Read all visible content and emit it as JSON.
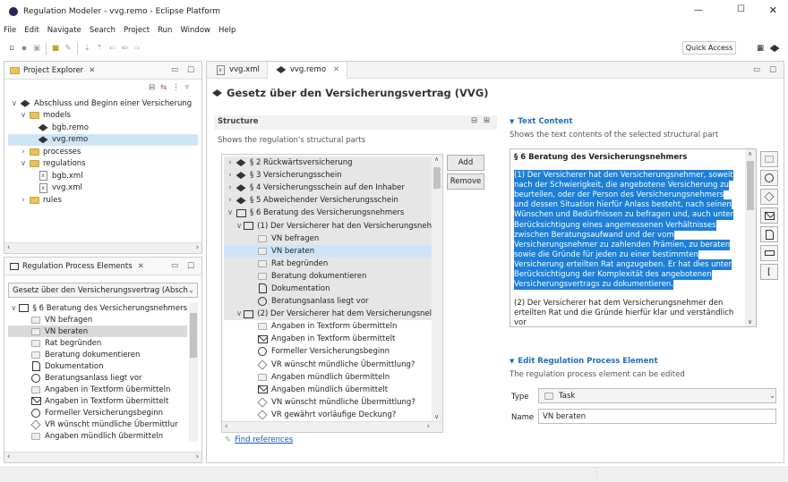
{
  "window": {
    "title": "Regulation Modeler - vvg.remo - Eclipse Platform",
    "min": "—",
    "max": "☐",
    "close": "✕"
  },
  "menu": [
    "File",
    "Edit",
    "Navigate",
    "Search",
    "Project",
    "Run",
    "Window",
    "Help"
  ],
  "toolbar": {
    "quick_access": "Quick Access"
  },
  "project_explorer": {
    "title": "Project Explorer",
    "close": "✕",
    "items": [
      {
        "label": "Abschluss und Beginn einer Versicherung",
        "indent": 0,
        "caret": "∨",
        "icon": "remo"
      },
      {
        "label": "models",
        "indent": 1,
        "caret": "∨",
        "icon": "folder"
      },
      {
        "label": "bgb.remo",
        "indent": 2,
        "caret": "",
        "icon": "remo"
      },
      {
        "label": "vvg.remo",
        "indent": 2,
        "caret": "",
        "icon": "remo",
        "selected": true
      },
      {
        "label": "processes",
        "indent": 1,
        "caret": "›",
        "icon": "folder"
      },
      {
        "label": "regulations",
        "indent": 1,
        "caret": "∨",
        "icon": "folder"
      },
      {
        "label": "bgb.xml",
        "indent": 2,
        "caret": "",
        "icon": "xml"
      },
      {
        "label": "vvg.xml",
        "indent": 2,
        "caret": "",
        "icon": "xml"
      },
      {
        "label": "rules",
        "indent": 1,
        "caret": "›",
        "icon": "folder"
      }
    ]
  },
  "rpe": {
    "title": "Regulation Process Elements",
    "close": "✕",
    "dropdown": "Gesetz über den Versicherungsvertrag (Abschlı",
    "items": [
      {
        "label": "§ 6 Beratung des Versicherungsnehmers",
        "icon": "book",
        "indent": 0,
        "caret": "∨"
      },
      {
        "label": "VN befragen",
        "icon": "task",
        "indent": 1
      },
      {
        "label": "VN beraten",
        "icon": "task",
        "indent": 1,
        "selected": true
      },
      {
        "label": "Rat begründen",
        "icon": "task",
        "indent": 1
      },
      {
        "label": "Beratung dokumentieren",
        "icon": "task",
        "indent": 1
      },
      {
        "label": "Dokumentation",
        "icon": "doc",
        "indent": 1
      },
      {
        "label": "Beratungsanlass liegt vor",
        "icon": "circle",
        "indent": 1
      },
      {
        "label": "Angaben in Textform übermitteln",
        "icon": "task",
        "indent": 1
      },
      {
        "label": "Angaben in Textform übermittelt",
        "icon": "env",
        "indent": 1
      },
      {
        "label": "Formeller Versicherungsbeginn",
        "icon": "circle",
        "indent": 1
      },
      {
        "label": "VR wünscht mündliche Übermittlur",
        "icon": "dia",
        "indent": 1
      },
      {
        "label": "Angaben mündlich übermitteln",
        "icon": "task",
        "indent": 1
      }
    ]
  },
  "editor": {
    "tabs": [
      {
        "label": "vvg.xml",
        "icon": "xml"
      },
      {
        "label": "vvg.remo",
        "icon": "remo",
        "active": true,
        "close": "✕"
      }
    ],
    "heading": "Gesetz über den Versicherungsvertrag (VVG)",
    "structure": {
      "title": "Structure",
      "desc": "Shows the regulation's structural parts",
      "add": "Add",
      "remove": "Remove",
      "items": [
        {
          "label": "§ 2 Rückwärtsversicherung",
          "icon": "remo",
          "indent": 0,
          "caret": "›"
        },
        {
          "label": "§ 3 Versicherungsschein",
          "icon": "remo",
          "indent": 0,
          "caret": "›"
        },
        {
          "label": "§ 4 Versicherungsschein auf den Inhaber",
          "icon": "remo",
          "indent": 0,
          "caret": "›"
        },
        {
          "label": "§ 5 Abweichender Versicherungsschein",
          "icon": "remo",
          "indent": 0,
          "caret": "›"
        },
        {
          "label": "§ 6 Beratung des Versicherungsnehmers",
          "icon": "book",
          "indent": 0,
          "caret": "∨"
        },
        {
          "label": "(1) Der Versicherer hat den Versicherungsneh",
          "icon": "book",
          "indent": 1,
          "caret": "∨"
        },
        {
          "label": "VN befragen",
          "icon": "task",
          "indent": 2
        },
        {
          "label": "VN beraten",
          "icon": "task",
          "indent": 2,
          "selected": true
        },
        {
          "label": "Rat begründen",
          "icon": "task",
          "indent": 2
        },
        {
          "label": "Beratung dokumentieren",
          "icon": "task",
          "indent": 2
        },
        {
          "label": "Dokumentation",
          "icon": "doc",
          "indent": 2
        },
        {
          "label": "Beratungsanlass liegt vor",
          "icon": "circle",
          "indent": 2
        },
        {
          "label": "(2) Der Versicherer hat dem Versicherungsnel",
          "icon": "book",
          "indent": 1,
          "caret": "∨"
        },
        {
          "label": "Angaben in Textform übermitteln",
          "icon": "task",
          "indent": 2
        },
        {
          "label": "Angaben in Textform übermittelt",
          "icon": "env",
          "indent": 2
        },
        {
          "label": "Formeller Versicherungsbeginn",
          "icon": "circle",
          "indent": 2
        },
        {
          "label": "VR wünscht mündliche Übermittlung?",
          "icon": "dia",
          "indent": 2
        },
        {
          "label": "Angaben mündlich übermitteln",
          "icon": "task",
          "indent": 2
        },
        {
          "label": "Angaben mündlich übermittelt",
          "icon": "env",
          "indent": 2
        },
        {
          "label": "VN wünscht mündliche Übermittlung?",
          "icon": "dia",
          "indent": 2
        },
        {
          "label": "VR gewährt vorläufige Deckung?",
          "icon": "dia",
          "indent": 2
        }
      ],
      "find_refs": "Find references"
    },
    "text_content": {
      "title": "Text Content",
      "desc": "Shows the text contents of the selected structural part",
      "para_title": "§ 6 Beratung des Versicherungsnehmers",
      "highlighted": "(1) Der Versicherer hat den Versicherungsnehmer, soweit nach der Schwierigkeit, die angebotene Versicherung zu beurteilen, oder der Person des Versicherungsnehmers und dessen Situation hierfür Anlass besteht, nach seinen Wünschen und Bedürfnissen zu befragen und, auch unter Berücksichtigung eines angemessenen Verhältnisses zwischen Beratungsaufwand und der vom Versicherungsnehmer zu zahlenden Prämien, zu beraten sowie die Gründe für jeden zu einer bestimmten Versicherung erteilten Rat angzugeben. Er hat dies unter Berücksichtigung der Komplexität des angebotenen Versicherungsvertrags zu dokumentieren.",
      "rest": "(2) Der Versicherer hat dem Versicherungsnehmer den erteilten Rat und die Gründe hierfür klar und verständlich vor"
    },
    "edit": {
      "title": "Edit Regulation Process Element",
      "desc": "The regulation process element can be edited",
      "type_label": "Type",
      "type_value": "Task",
      "name_label": "Name",
      "name_value": "VN beraten"
    }
  }
}
